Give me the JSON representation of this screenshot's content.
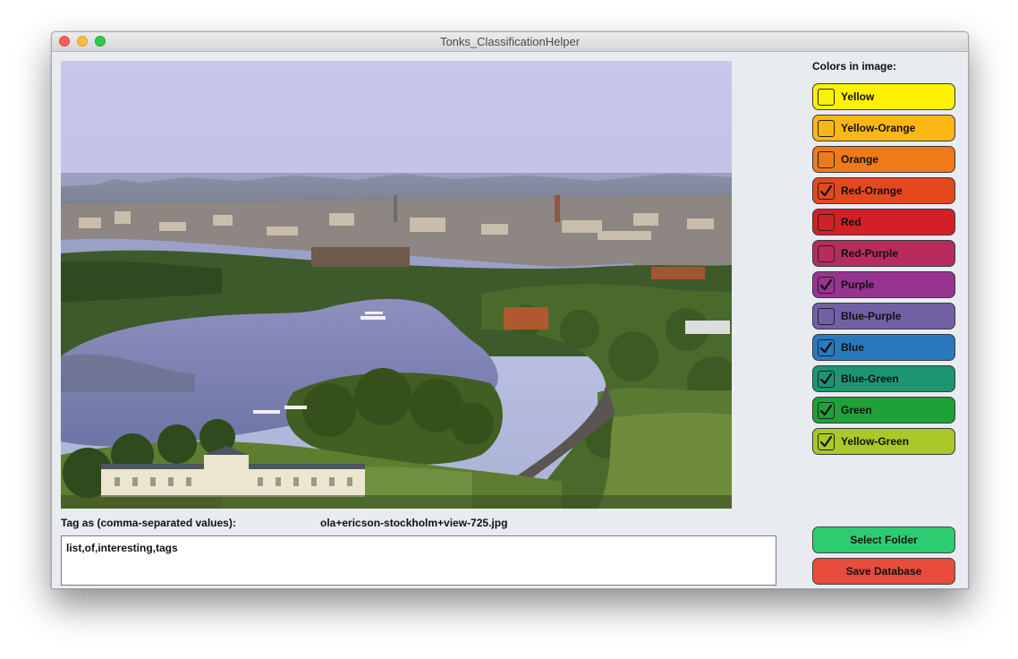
{
  "window": {
    "title": "Tonks_ClassificationHelper"
  },
  "colors_header": "Colors in image:",
  "colors": [
    {
      "label": "Yellow",
      "checked": false,
      "color": "#fff200"
    },
    {
      "label": "Yellow-Orange",
      "checked": false,
      "color": "#fbb714"
    },
    {
      "label": "Orange",
      "checked": false,
      "color": "#ef7a1a"
    },
    {
      "label": "Red-Orange",
      "checked": true,
      "color": "#e4481d"
    },
    {
      "label": "Red",
      "checked": false,
      "color": "#d41f26"
    },
    {
      "label": "Red-Purple",
      "checked": false,
      "color": "#b82c5d"
    },
    {
      "label": "Purple",
      "checked": true,
      "color": "#963490"
    },
    {
      "label": "Blue-Purple",
      "checked": false,
      "color": "#7260a5"
    },
    {
      "label": "Blue",
      "checked": true,
      "color": "#2b79bd"
    },
    {
      "label": "Blue-Green",
      "checked": true,
      "color": "#1d9573"
    },
    {
      "label": "Green",
      "checked": true,
      "color": "#1fa13a"
    },
    {
      "label": "Yellow-Green",
      "checked": true,
      "color": "#a9c927"
    }
  ],
  "tag_label": "Tag as (comma-separated values):",
  "filename": "ola+ericson-stockholm+view-725.jpg",
  "tag_value": "list,of,interesting,tags",
  "buttons": {
    "select_folder": {
      "label": "Select Folder",
      "color": "#2ecc71"
    },
    "save_database": {
      "label": "Save Database",
      "color": "#e74c3c"
    }
  }
}
